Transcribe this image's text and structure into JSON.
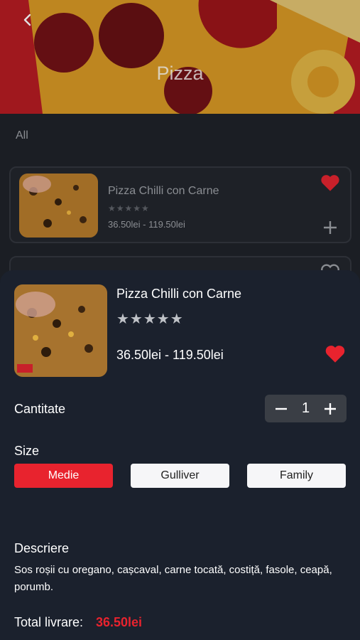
{
  "header": {
    "title": "Pizza"
  },
  "tabs": [
    {
      "label": "All"
    }
  ],
  "list_items": [
    {
      "name": "Pizza Chilli con Carne",
      "stars": "★★★★★",
      "price": "36.50lei  - 119.50lei"
    }
  ],
  "sheet": {
    "name": "Pizza Chilli con Carne",
    "stars": "★★★★★",
    "price": "36.50lei  - 119.50lei",
    "quantity_label": "Cantitate",
    "quantity": "1",
    "size_label": "Size",
    "sizes": [
      {
        "label": "Medie",
        "selected": true
      },
      {
        "label": "Gulliver",
        "selected": false
      },
      {
        "label": "Family",
        "selected": false
      }
    ],
    "description_label": "Descriere",
    "description": "Sos roșii cu oregano, cașcaval, carne tocată, costiță, fasole, ceapă, porumb.",
    "total_label": "Total livrare:",
    "total_value": "36.50lei"
  },
  "colors": {
    "accent": "#e8232e",
    "background": "#1b212d",
    "stepper": "#3a3e45"
  },
  "icons": {
    "back": "chevron-left-icon",
    "favorite": "heart-icon",
    "add": "plus-icon",
    "decrement": "minus-icon",
    "increment": "plus-icon"
  }
}
